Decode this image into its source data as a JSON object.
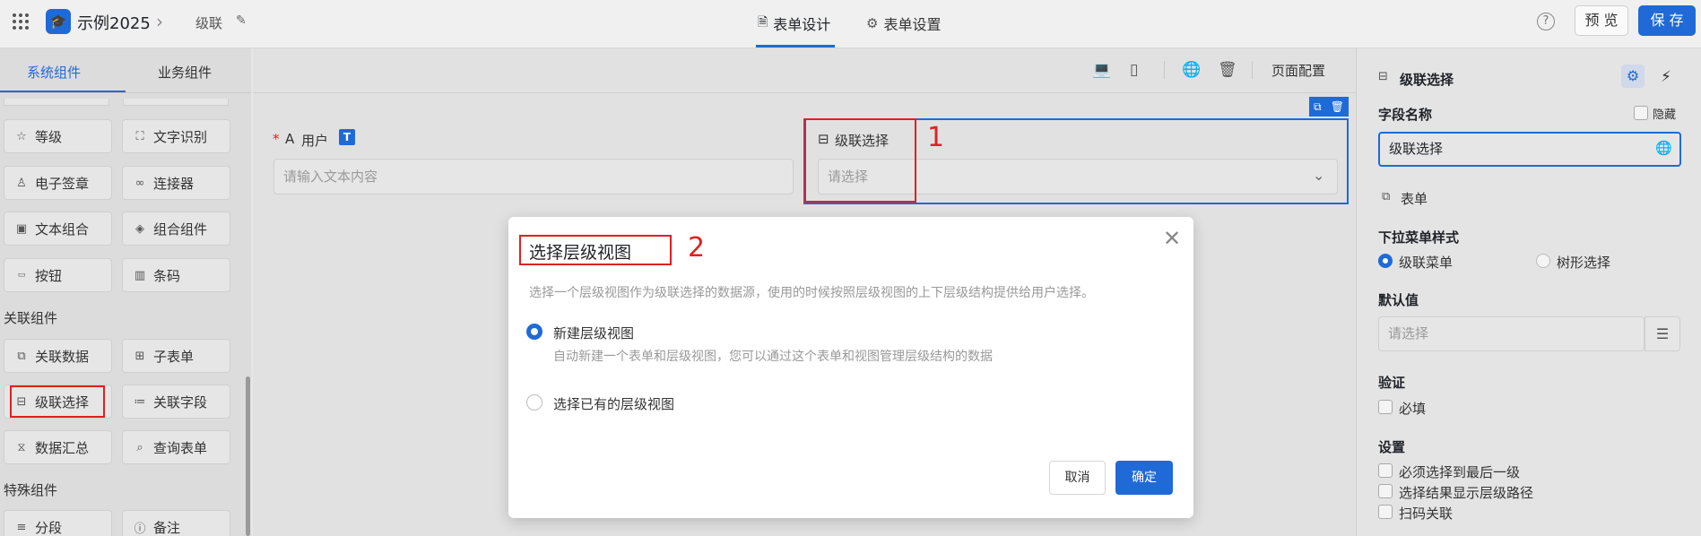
{
  "header": {
    "app_title": "示例2025",
    "breadcrumb": "级联",
    "tabs": [
      {
        "label": "表单设计",
        "icon": "document-icon",
        "active": true
      },
      {
        "label": "表单设置",
        "icon": "gear-icon",
        "active": false
      }
    ],
    "help": "?",
    "preview_label": "预 览",
    "save_label": "保 存",
    "accent_color": "#1f6ad6"
  },
  "left_panel": {
    "tabs": [
      "系统组件",
      "业务组件"
    ],
    "items_a": [
      {
        "label": "等级",
        "icon": "star-icon"
      },
      {
        "label": "文字识别",
        "icon": "scan-text-icon"
      },
      {
        "label": "电子签章",
        "icon": "stamp-icon"
      },
      {
        "label": "连接器",
        "icon": "link-icon"
      },
      {
        "label": "文本组合",
        "icon": "text-combo-icon"
      },
      {
        "label": "组合组件",
        "icon": "layers-icon"
      },
      {
        "label": "按钮",
        "icon": "button-icon"
      },
      {
        "label": "条码",
        "icon": "barcode-icon"
      }
    ],
    "section_related": "关联组件",
    "items_b": [
      {
        "label": "关联数据",
        "icon": "relation-icon"
      },
      {
        "label": "子表单",
        "icon": "table-icon"
      },
      {
        "label": "级联选择",
        "icon": "cascade-icon"
      },
      {
        "label": "关联字段",
        "icon": "field-link-icon"
      },
      {
        "label": "数据汇总",
        "icon": "sigma-icon"
      },
      {
        "label": "查询表单",
        "icon": "query-icon"
      }
    ],
    "section_special": "特殊组件",
    "items_c": [
      {
        "label": "分段",
        "icon": "segment-icon"
      },
      {
        "label": "备注",
        "icon": "info-icon"
      }
    ]
  },
  "canvas": {
    "page_config": "页面配置",
    "user_field": {
      "required_mark": "*",
      "label": "用户",
      "type_badge": "T",
      "placeholder": "请输入文本内容"
    },
    "cascade_field": {
      "label": "级联选择",
      "placeholder": "请选择"
    },
    "annotation_1": "1",
    "annotation_2": "2"
  },
  "modal": {
    "title": "选择层级视图",
    "description": "选择一个层级视图作为级联选择的数据源，使用的时候按照层级视图的上下层级结构提供给用户选择。",
    "option_new": {
      "label": "新建层级视图",
      "sub": "自动新建一个表单和层级视图，您可以通过这个表单和视图管理层级结构的数据",
      "selected": true
    },
    "option_existing": {
      "label": "选择已有的层级视图",
      "selected": false
    },
    "cancel_label": "取消",
    "ok_label": "确定"
  },
  "right_panel": {
    "title": "级联选择",
    "field_name_label": "字段名称",
    "hidden_label": "隐藏",
    "field_name_value": "级联选择",
    "form_link": "表单",
    "dropdown_style_label": "下拉菜单样式",
    "style_options": [
      {
        "label": "级联菜单",
        "selected": true
      },
      {
        "label": "树形选择",
        "selected": false
      }
    ],
    "default_label": "默认值",
    "default_placeholder": "请选择",
    "validate_label": "验证",
    "required_label": "必填",
    "settings_label": "设置",
    "settings_options": [
      "必须选择到最后一级",
      "选择结果显示层级路径",
      "扫码关联"
    ]
  }
}
